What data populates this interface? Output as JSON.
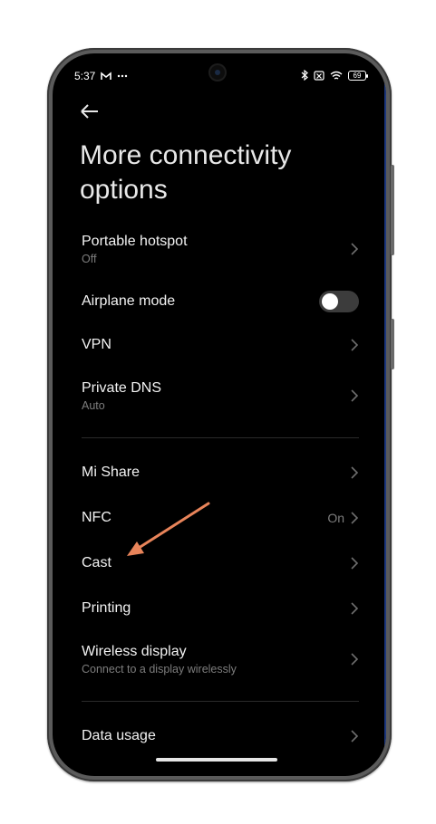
{
  "status_bar": {
    "time": "5:37",
    "left_icons": [
      "gmail-icon",
      "more-dots-icon"
    ],
    "right_icons": [
      "bluetooth-icon",
      "sim-disabled-icon",
      "wifi-icon"
    ],
    "battery_level": "69"
  },
  "header": {
    "back_icon": "back-arrow-icon",
    "title": "More connectivity options"
  },
  "settings": {
    "portable_hotspot": {
      "label": "Portable hotspot",
      "sub": "Off"
    },
    "airplane_mode": {
      "label": "Airplane mode",
      "enabled": false
    },
    "vpn": {
      "label": "VPN"
    },
    "private_dns": {
      "label": "Private DNS",
      "sub": "Auto"
    },
    "mi_share": {
      "label": "Mi Share"
    },
    "nfc": {
      "label": "NFC",
      "value": "On"
    },
    "cast": {
      "label": "Cast"
    },
    "printing": {
      "label": "Printing"
    },
    "wireless_display": {
      "label": "Wireless display",
      "sub": "Connect to a display wirelessly"
    },
    "data_usage": {
      "label": "Data usage"
    }
  },
  "colors": {
    "screen_background": "#000000",
    "annotation_arrow": "#e8845a",
    "frame": "#5b5b5b"
  }
}
